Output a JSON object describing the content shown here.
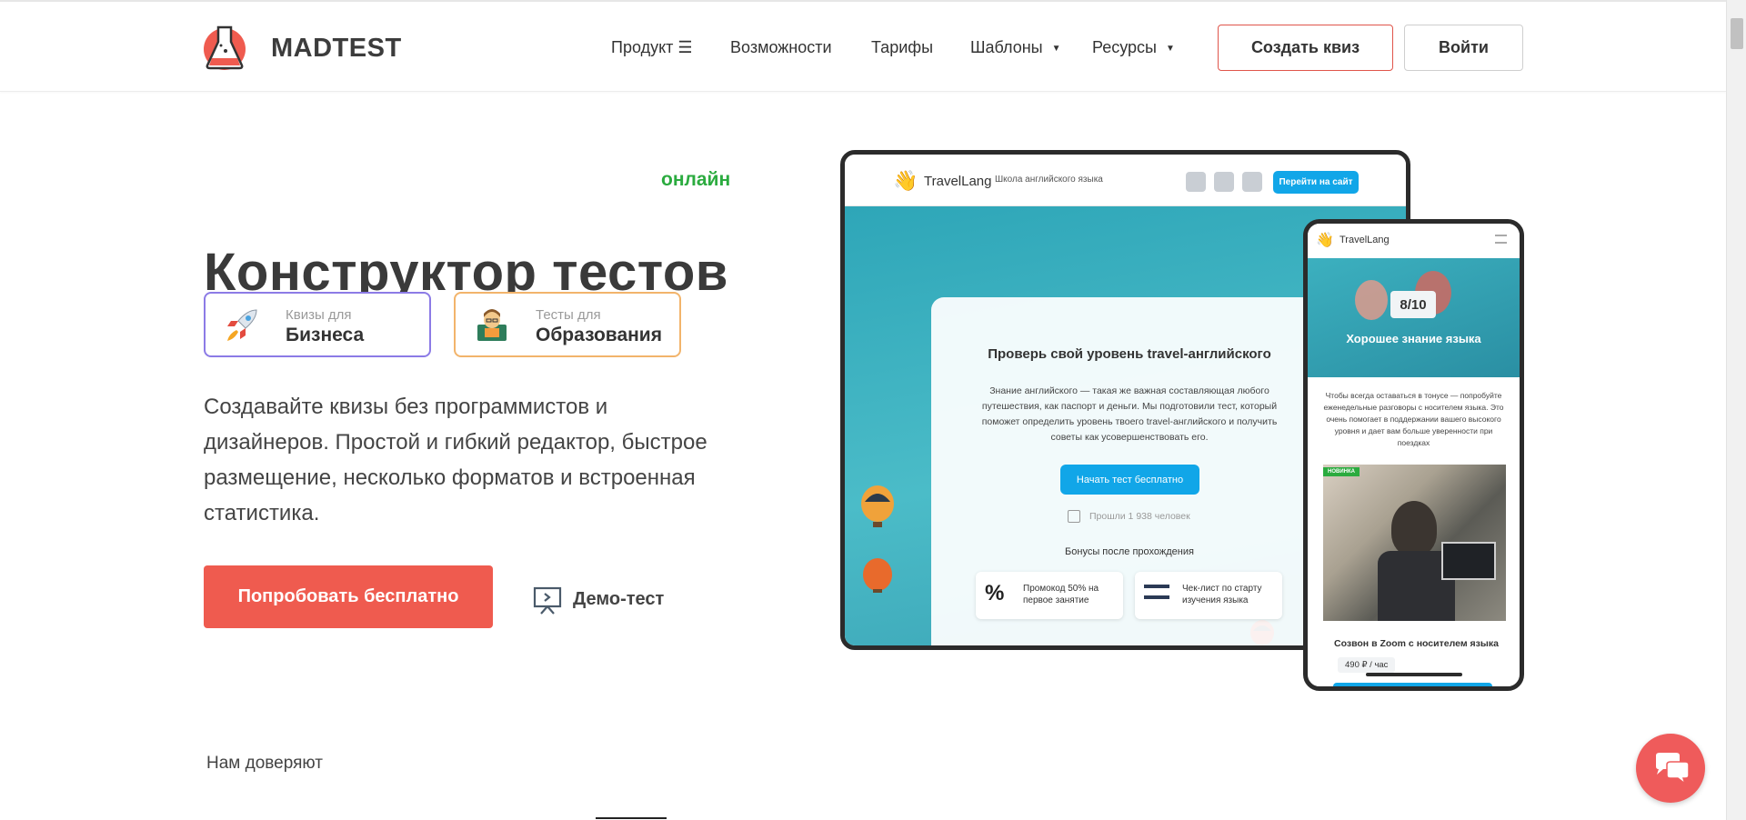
{
  "header": {
    "logo_text": "MADTEST",
    "nav": [
      {
        "label": "Продукт ☰"
      },
      {
        "label": "Возможности"
      },
      {
        "label": "Тарифы"
      },
      {
        "label": "Шаблоны"
      },
      {
        "label": "Ресурсы"
      }
    ],
    "create_quiz_label": "Создать квиз",
    "login_label": "Войти"
  },
  "hero": {
    "online_word": "онлайн",
    "title": "Конструктор тестов",
    "pill_business": {
      "sub": "Квизы для",
      "main": "Бизнеса"
    },
    "pill_education": {
      "sub": "Тесты для",
      "main": "Образования"
    },
    "description": "Создавайте квизы без программистов и дизайнеров. Простой и гибкий редактор, быстрое размещение, несколько форматов и встроенная статистика.",
    "cta_label": "Попробовать бесплатно",
    "demo_label": "Демо-тест",
    "trust_label": "Нам доверяют"
  },
  "laptop_preview": {
    "brand": "TravelLang",
    "tagline": "Школа английского языка",
    "site_button": "Перейти на сайт",
    "quiz_title": "Проверь свой уровень travel-английского",
    "quiz_text": "Знание английского — такая же важная составляющая любого путешествия, как паспорт и деньги. Мы подготовили тест, который поможет определить уровень твоего travel-английского и получить советы как усовершенствовать его.",
    "start_button": "Начать тест бесплатно",
    "passed": "Прошли 1 938 человек",
    "bonus_title": "Бонусы после прохождения",
    "bonus_1": "Промокод 50% на первое занятие",
    "bonus_2": "Чек-лист по старту изучения языка"
  },
  "phone_preview": {
    "brand": "TravelLang",
    "score": "8/10",
    "result": "Хорошее знание языка",
    "text": "Чтобы всегда оставаться в тонусе — попробуйте еженедельные разговоры с носителем языка. Это очень помогает в поддержании вашего высокого уровня и дает вам больше уверенности при поездках",
    "badge": "НОВИНКА",
    "offer_title": "Созвон в Zoom с носителем языка",
    "price": "490 ₽ / час"
  },
  "colors": {
    "brand_red": "#ef5b4f",
    "online_green": "#2bab3f",
    "pill_purple": "#8c7be6",
    "pill_orange": "#f2b46b",
    "teal": "#3aa8b8",
    "blue_button": "#11a6e8"
  },
  "icons": [
    "flask-logo-icon",
    "rocket-icon",
    "teacher-icon",
    "presentation-icon",
    "wave-hand-icon",
    "vk-icon",
    "telegram-icon",
    "whatsapp-icon",
    "menu-icon",
    "chat-icon"
  ]
}
